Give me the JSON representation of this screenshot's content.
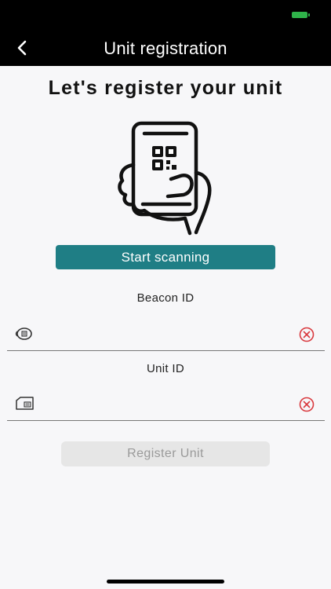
{
  "status_bar": {
    "battery_color": "#2fb34a"
  },
  "nav": {
    "title": "Unit registration",
    "back_icon": "chevron-left-icon"
  },
  "headline": "Let's register your unit",
  "illustration": {
    "icon": "hand-phone-qr-icon"
  },
  "scan_button": {
    "label": "Start scanning",
    "color": "#1f7e85"
  },
  "beacon": {
    "label": "Beacon ID",
    "value": "",
    "placeholder": "",
    "icon": "beacon-icon",
    "clear_icon": "clear-circle-icon"
  },
  "unit": {
    "label": "Unit ID",
    "value": "",
    "placeholder": "",
    "icon": "unit-card-icon",
    "clear_icon": "clear-circle-icon"
  },
  "register_button": {
    "label": "Register Unit",
    "disabled": true
  },
  "colors": {
    "clear_red": "#d9393e",
    "nav_bg": "#000000",
    "page_bg": "#f7f7f9"
  }
}
